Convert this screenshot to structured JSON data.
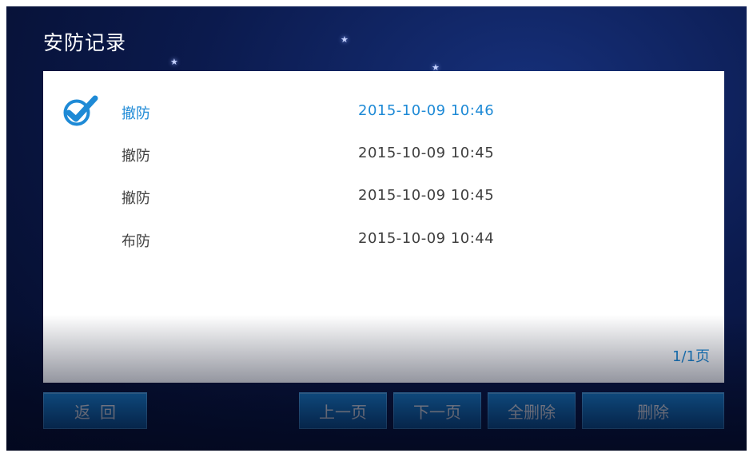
{
  "header": {
    "title": "安防记录"
  },
  "records": [
    {
      "type": "撤防",
      "time": "2015-10-09  10:46",
      "selected": true
    },
    {
      "type": "撤防",
      "time": "2015-10-09  10:45",
      "selected": false
    },
    {
      "type": "撤防",
      "time": "2015-10-09  10:45",
      "selected": false
    },
    {
      "type": "布防",
      "time": "2015-10-09  10:44",
      "selected": false
    }
  ],
  "pager": {
    "text": "1/1页"
  },
  "buttons": {
    "back": "返回",
    "prev": "上一页",
    "next": "下一页",
    "delete_all": "全删除",
    "delete": "删除"
  },
  "colors": {
    "accent": "#1e8ad6",
    "button": "#1376c4",
    "background": "#0b1a4d",
    "text": "#3f3f3f"
  },
  "icons": {
    "selected": "checkmark-circle-icon",
    "star": "star-icon"
  }
}
